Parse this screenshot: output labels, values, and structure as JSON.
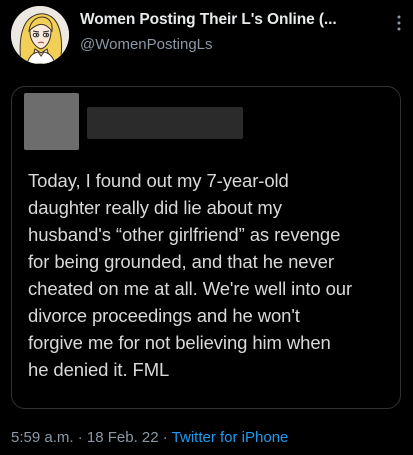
{
  "account": {
    "display_name": "Women Posting Their L's Online (...",
    "handle": "@WomenPostingLs"
  },
  "embedded_post": {
    "text": "Today, I found out my 7-year-old\ndaughter really did lie about my\nhusband's “other girlfriend” as revenge\nfor being grounded, and that he never\ncheated on me at all. We're well into our\ndivorce proceedings and he won't\nforgive me for not believing him when\nhe denied it. FML"
  },
  "meta": {
    "time": "5:59 a.m.",
    "separator": " · ",
    "date": "18 Feb. 22",
    "source": "Twitter for iPhone"
  },
  "icons": {
    "more": "more-vertical-icon",
    "avatar": "cartoon-woman-avatar"
  },
  "colors": {
    "background": "#000000",
    "primary_text": "#e7e9ea",
    "secondary_text": "#8b98a5",
    "link": "#1d9bf0"
  }
}
